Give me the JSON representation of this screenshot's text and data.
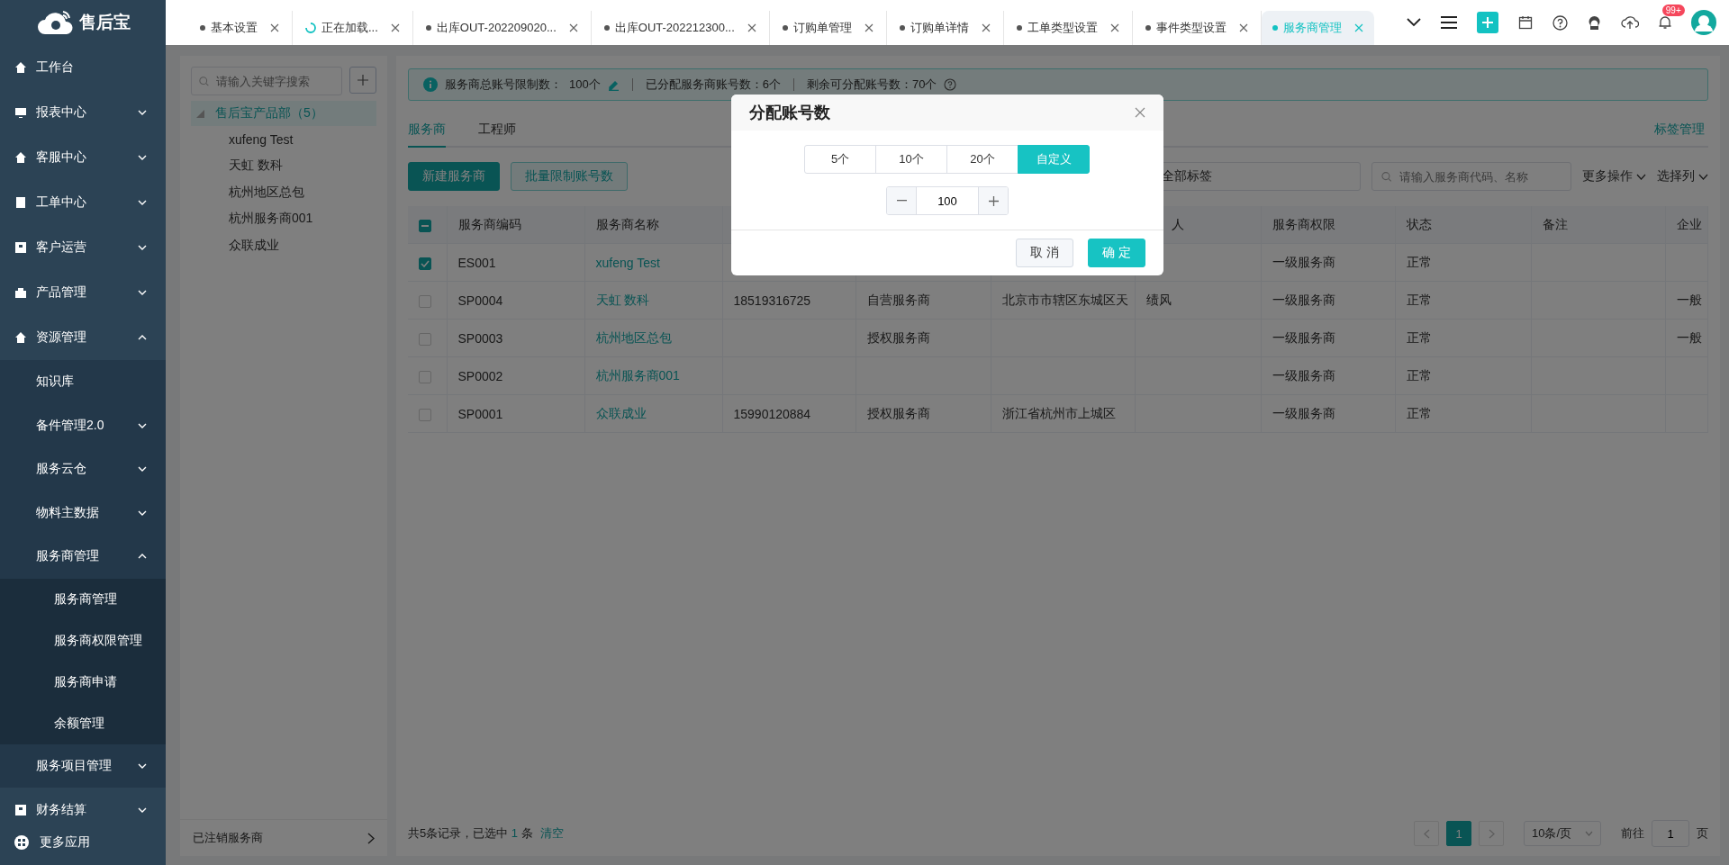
{
  "sidebar": {
    "logo": "售后宝",
    "items": [
      {
        "label": "工作台"
      },
      {
        "label": "报表中心",
        "expanded": false
      },
      {
        "label": "客服中心",
        "expanded": false
      },
      {
        "label": "工单中心",
        "expanded": false
      },
      {
        "label": "客户运营",
        "expanded": false
      },
      {
        "label": "产品管理",
        "expanded": false
      },
      {
        "label": "资源管理",
        "expanded": true,
        "children": [
          {
            "label": "知识库"
          },
          {
            "label": "备件管理2.0",
            "expanded": false
          },
          {
            "label": "服务云仓",
            "expanded": false
          },
          {
            "label": "物料主数据",
            "expanded": false
          },
          {
            "label": "服务商管理",
            "expanded": true,
            "children": [
              {
                "label": "服务商管理"
              },
              {
                "label": "服务商权限管理"
              },
              {
                "label": "服务商申请"
              },
              {
                "label": "余额管理"
              }
            ]
          },
          {
            "label": "服务项目管理",
            "expanded": false
          }
        ]
      },
      {
        "label": "财务结算",
        "expanded": false
      }
    ],
    "footer": "更多应用"
  },
  "tabs": [
    {
      "label": "基本设置",
      "kind": "page",
      "selected": false
    },
    {
      "label": "正在加载...",
      "kind": "loading",
      "selected": false
    },
    {
      "label": "出库OUT-202209020...",
      "kind": "page",
      "selected": false
    },
    {
      "label": "出库OUT-202212300...",
      "kind": "page",
      "selected": false
    },
    {
      "label": "订购单管理",
      "kind": "page",
      "selected": false
    },
    {
      "label": "订购单详情",
      "kind": "page",
      "selected": false
    },
    {
      "label": "工单类型设置",
      "kind": "page",
      "selected": false
    },
    {
      "label": "事件类型设置",
      "kind": "page",
      "selected": false
    },
    {
      "label": "服务商管理",
      "kind": "page",
      "selected": true
    }
  ],
  "notification_badge": "99+",
  "tree": {
    "search_placeholder": "请输入关键字搜索",
    "root": {
      "label": "售后宝产品部（5）",
      "expanded": true,
      "selected": true,
      "children": [
        {
          "label": "xufeng Test"
        },
        {
          "label": "天虹 数科"
        },
        {
          "label": "杭州地区总包"
        },
        {
          "label": "杭州服务商001"
        },
        {
          "label": "众联成业"
        }
      ]
    },
    "footer": "已注销服务商"
  },
  "info_bar": {
    "total_label": "服务商总账号限制数：",
    "total_value": "100个",
    "assigned": "已分配服务商账号数：6个",
    "remaining": "剩余可分配账号数：70个"
  },
  "sub_tabs": [
    {
      "label": "服务商",
      "selected": true
    },
    {
      "label": "工程师",
      "selected": false
    }
  ],
  "tag_link": "标签管理",
  "toolbar": {
    "buttons": [
      {
        "label": "新建服务商",
        "kind": "primary"
      },
      {
        "label": "批量限制账号数",
        "kind": "plain"
      }
    ],
    "tag_select": "全部标签",
    "search_placeholder": "请输入服务商代码、名称",
    "more": "更多操作",
    "columns": "选择列"
  },
  "table": {
    "select_all_indeterminate": true,
    "header": {
      "code": "服务商编码",
      "name": "服务商名称",
      "contact": "人",
      "permission": "服务商权限",
      "status": "状态",
      "remark": "备注",
      "company": "企业"
    },
    "rows": [
      {
        "checked": true,
        "code": "ES001",
        "name": "xufeng Test",
        "permission": "一级服务商",
        "status": "正常"
      },
      {
        "checked": false,
        "code": "SP0004",
        "name": "天虹 数科",
        "phone": "18519316725",
        "type": "自营服务商",
        "address": "北京市市辖区东城区天",
        "contact": "绩风",
        "permission": "一级服务商",
        "status": "正常",
        "company": "一般"
      },
      {
        "checked": false,
        "code": "SP0003",
        "name": "杭州地区总包",
        "type": "授权服务商",
        "permission": "一级服务商",
        "status": "正常",
        "company": "一般"
      },
      {
        "checked": false,
        "code": "SP0002",
        "name": "杭州服务商001",
        "permission": "一级服务商",
        "status": "正常"
      },
      {
        "checked": false,
        "code": "SP0001",
        "name": "众联成业",
        "phone": "15990120884",
        "type": "授权服务商",
        "address": "浙江省杭州市上城区",
        "permission": "一级服务商",
        "status": "正常"
      }
    ]
  },
  "footer": {
    "total": "共5条记录，",
    "selected_prefix": "已选中",
    "selected_count": "1",
    "selected_suffix": "条",
    "clear": "清空",
    "pages": [
      {
        "label": "1",
        "selected": true
      }
    ],
    "page_size": "10条/页",
    "goto_label": "前往",
    "goto_value": "1",
    "goto_suffix": "页"
  },
  "dialog": {
    "title": "分配账号数",
    "options": [
      {
        "label": "5个",
        "selected": false
      },
      {
        "label": "10个",
        "selected": false
      },
      {
        "label": "20个",
        "selected": false
      },
      {
        "label": "自定义",
        "selected": true
      }
    ],
    "value": "100",
    "cancel": "取 消",
    "confirm": "确 定"
  }
}
